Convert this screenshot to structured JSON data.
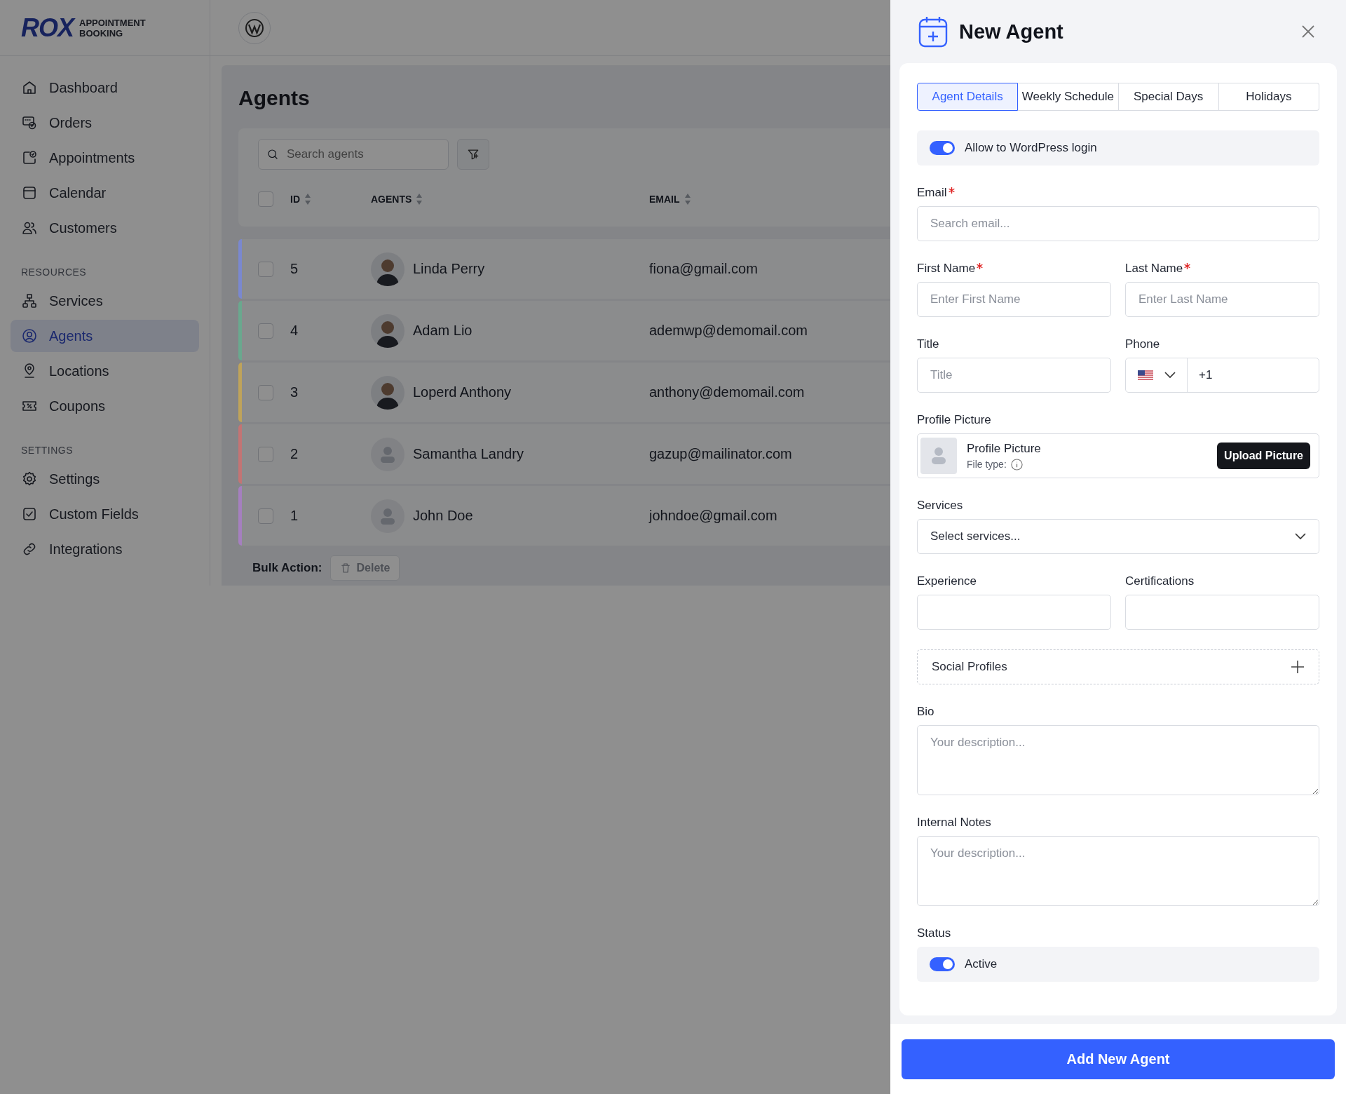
{
  "brand": {
    "logo": "ROX",
    "tagline_1": "APPOINTMENT",
    "tagline_2": "BOOKING"
  },
  "sidebar": {
    "sections": [
      {
        "items": [
          {
            "label": "Dashboard",
            "selected": false
          },
          {
            "label": "Orders",
            "selected": false
          },
          {
            "label": "Appointments",
            "selected": false
          },
          {
            "label": "Calendar",
            "selected": false
          },
          {
            "label": "Customers",
            "selected": false
          }
        ]
      },
      {
        "heading": "RESOURCES",
        "items": [
          {
            "label": "Services",
            "selected": false
          },
          {
            "label": "Agents",
            "selected": true
          },
          {
            "label": "Locations",
            "selected": false
          },
          {
            "label": "Coupons",
            "selected": false
          }
        ]
      },
      {
        "heading": "SETTINGS",
        "items": [
          {
            "label": "Settings",
            "selected": false
          },
          {
            "label": "Custom Fields",
            "selected": false
          },
          {
            "label": "Integrations",
            "selected": false
          }
        ]
      }
    ]
  },
  "page": {
    "title": "Agents",
    "search": {
      "placeholder": "Search agents"
    },
    "table": {
      "header_checked": false,
      "columns": [
        "ID",
        "AGENTS",
        "EMAIL"
      ],
      "rows": [
        {
          "id": "5",
          "name": "Linda Perry",
          "email": "fiona@gmail.com",
          "photo": true,
          "color": "#7a88cf",
          "checked": false
        },
        {
          "id": "4",
          "name": "Adam Lio",
          "email": "ademwp@demomail.com",
          "photo": true,
          "color": "#6aa88e",
          "checked": false
        },
        {
          "id": "3",
          "name": "Loperd Anthony",
          "email": "anthony@demomail.com",
          "photo": true,
          "color": "#bfa35a",
          "checked": false
        },
        {
          "id": "2",
          "name": "Samantha Landry",
          "email": "gazup@mailinator.com",
          "photo": false,
          "color": "#c37474",
          "checked": false
        },
        {
          "id": "1",
          "name": "John Doe",
          "email": "johndoe@gmail.com",
          "photo": false,
          "color": "#a57fbf",
          "checked": false
        }
      ]
    },
    "bulk_action": {
      "label": "Bulk Action:",
      "button": "Delete"
    }
  },
  "drawer": {
    "title": "New Agent",
    "tabs": [
      {
        "label": "Agent Details",
        "selected": true
      },
      {
        "label": "Weekly Schedule",
        "selected": false
      },
      {
        "label": "Special Days",
        "selected": false
      },
      {
        "label": "Holidays",
        "selected": false
      }
    ],
    "fields": [
      {
        "kind": "toggle",
        "text": "Allow to WordPress login",
        "on": true
      },
      {
        "kind": "text",
        "label": "Email",
        "required": true,
        "placeholder": "Search email..."
      },
      {
        "kind": "pair",
        "items": [
          {
            "kind": "text",
            "label": "First Name",
            "required": true,
            "placeholder": "Enter First Name"
          },
          {
            "kind": "text",
            "label": "Last Name",
            "required": true,
            "placeholder": "Enter Last Name"
          }
        ]
      },
      {
        "kind": "pair",
        "items": [
          {
            "kind": "text",
            "label": "Title",
            "required": false,
            "placeholder": "Title"
          },
          {
            "kind": "phone",
            "label": "Phone",
            "required": false,
            "value": "+1"
          }
        ]
      },
      {
        "kind": "profile",
        "label": "Profile Picture",
        "name": "Profile Picture",
        "file_type": "File type:",
        "button": "Upload Picture"
      },
      {
        "kind": "select",
        "label": "Services",
        "value": "Select services..."
      },
      {
        "kind": "pair",
        "items": [
          {
            "kind": "text",
            "label": "Experience",
            "required": false
          },
          {
            "kind": "text",
            "label": "Certifications",
            "required": false
          }
        ]
      },
      {
        "kind": "social",
        "text": "Social Profiles"
      },
      {
        "kind": "textarea",
        "label": "Bio",
        "placeholder": "Your description..."
      },
      {
        "kind": "textarea",
        "label": "Internal Notes",
        "placeholder": "Your description..."
      },
      {
        "kind": "toggle",
        "label": "Status",
        "text": "Active",
        "on": true
      }
    ],
    "submit": "Add New Agent"
  }
}
